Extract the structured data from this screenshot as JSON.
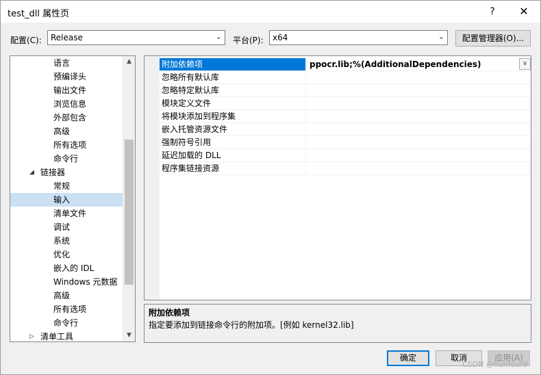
{
  "window": {
    "title": "test_dll 属性页",
    "help": "?",
    "close": "✕"
  },
  "toolbar": {
    "config_label": "配置(C):",
    "config_value": "Release",
    "platform_label": "平台(P):",
    "platform_value": "x64",
    "config_manager_label": "配置管理器(O)..."
  },
  "tree": {
    "items": [
      {
        "label": "语言"
      },
      {
        "label": "预编译头"
      },
      {
        "label": "输出文件"
      },
      {
        "label": "浏览信息"
      },
      {
        "label": "外部包含"
      },
      {
        "label": "高级"
      },
      {
        "label": "所有选项"
      },
      {
        "label": "命令行"
      },
      {
        "label": "链接器",
        "expander": "◢"
      },
      {
        "label": "常规"
      },
      {
        "label": "输入"
      },
      {
        "label": "清单文件"
      },
      {
        "label": "调试"
      },
      {
        "label": "系统"
      },
      {
        "label": "优化"
      },
      {
        "label": "嵌入的 IDL"
      },
      {
        "label": "Windows 元数据"
      },
      {
        "label": "高级"
      },
      {
        "label": "所有选项"
      },
      {
        "label": "命令行"
      },
      {
        "label": "清单工具",
        "expander": "▷"
      }
    ]
  },
  "grid": {
    "rows": [
      {
        "name": "附加依赖项",
        "value": "ppocr.lib;%(AdditionalDependencies)"
      },
      {
        "name": "忽略所有默认库",
        "value": ""
      },
      {
        "name": "忽略特定默认库",
        "value": ""
      },
      {
        "name": "模块定义文件",
        "value": ""
      },
      {
        "name": "将模块添加到程序集",
        "value": ""
      },
      {
        "name": "嵌入托管资源文件",
        "value": ""
      },
      {
        "name": "强制符号引用",
        "value": ""
      },
      {
        "name": "延迟加载的 DLL",
        "value": ""
      },
      {
        "name": "程序集链接资源",
        "value": ""
      }
    ]
  },
  "description": {
    "title": "附加依赖项",
    "text": "指定要添加到链接命令行的附加项。[例如 kernel32.lib]"
  },
  "buttons": {
    "ok": "确定",
    "cancel": "取消",
    "apply": "应用(A)"
  },
  "watermark": "CSDN @humour9",
  "colors": {
    "selection": "#0078d7",
    "tree_selection": "#cce0f4"
  }
}
